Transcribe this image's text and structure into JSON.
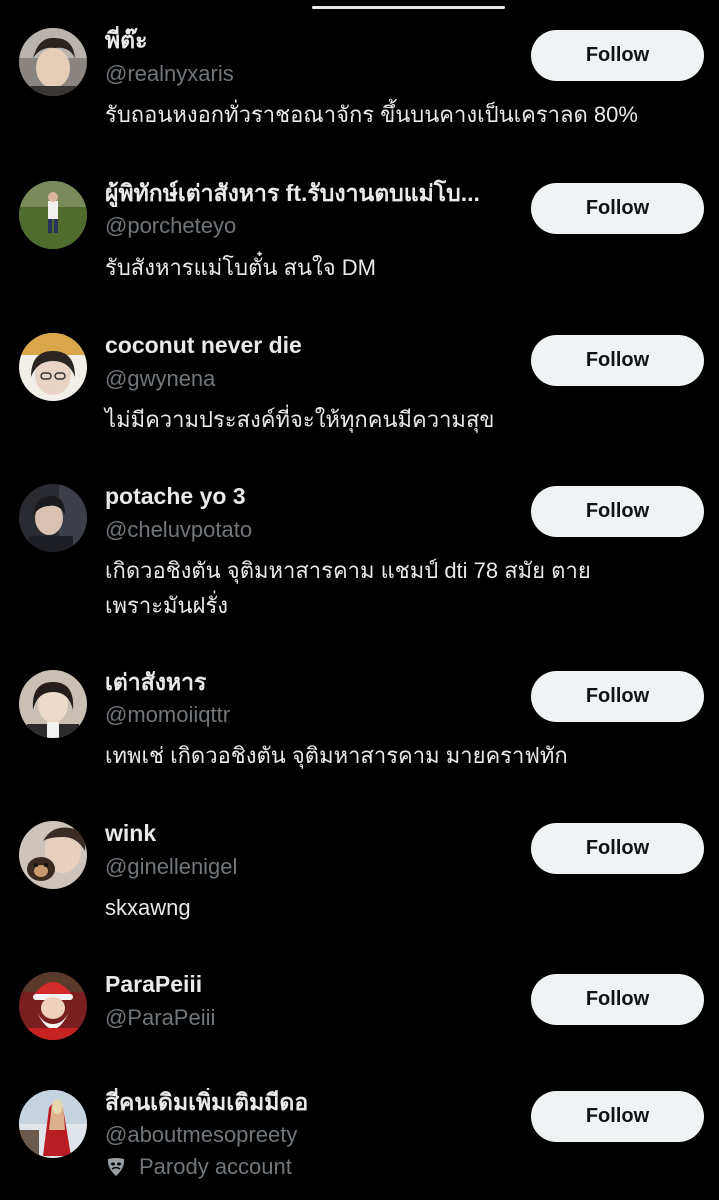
{
  "users": [
    {
      "display_name": "พี่ต๊ะ",
      "handle": "@realnyxaris",
      "bio": "รับถอนหงอกทั่วราชอณาจักร ขึ้นบนคางเป็นเคราลด 80%",
      "follow_label": "Follow"
    },
    {
      "display_name": "ผู้พิทักษ์เต่าสังหาร ft.รับงานตบแม่โบ...",
      "handle": "@porcheteyo",
      "bio": "รับสังหารแม่โบตั๋น สนใจ DM",
      "follow_label": "Follow"
    },
    {
      "display_name": "coconut never die",
      "handle": "@gwynena",
      "bio": "ไม่มีความประสงค์ที่จะให้ทุกคนมีความสุข",
      "follow_label": "Follow"
    },
    {
      "display_name": "potache yo 3",
      "handle": "@cheluvpotato",
      "bio_line1": "เกิดวอชิงตัน จุติมหาสารคาม แชมป์ dti 78 สมัย ตาย",
      "bio_line2": "เพราะมันฝรั่ง",
      "follow_label": "Follow"
    },
    {
      "display_name": "เต่าสังหาร",
      "handle": "@momoiiqttr",
      "bio": "เทพเช่ เกิดวอชิงตัน จุติมหาสารคาม มายคราฟทัก",
      "follow_label": "Follow"
    },
    {
      "display_name": "wink",
      "handle": "@ginellenigel",
      "bio": "skxawng",
      "follow_label": "Follow"
    },
    {
      "display_name": "ParaPeiii",
      "handle": "@ParaPeiii",
      "bio": "",
      "follow_label": "Follow"
    },
    {
      "display_name": "สี่คนเดิมเพิ่มเติมมีดอ",
      "handle": "@aboutmesopreety",
      "parody_label": "Parody account",
      "parody_icon": "theater-mask-icon",
      "follow_label": "Follow"
    }
  ],
  "colors": {
    "background": "#000000",
    "primary_text": "#e7e9ea",
    "secondary_text": "#71767b",
    "button_bg": "#eff3f4",
    "button_text": "#0f1419"
  }
}
